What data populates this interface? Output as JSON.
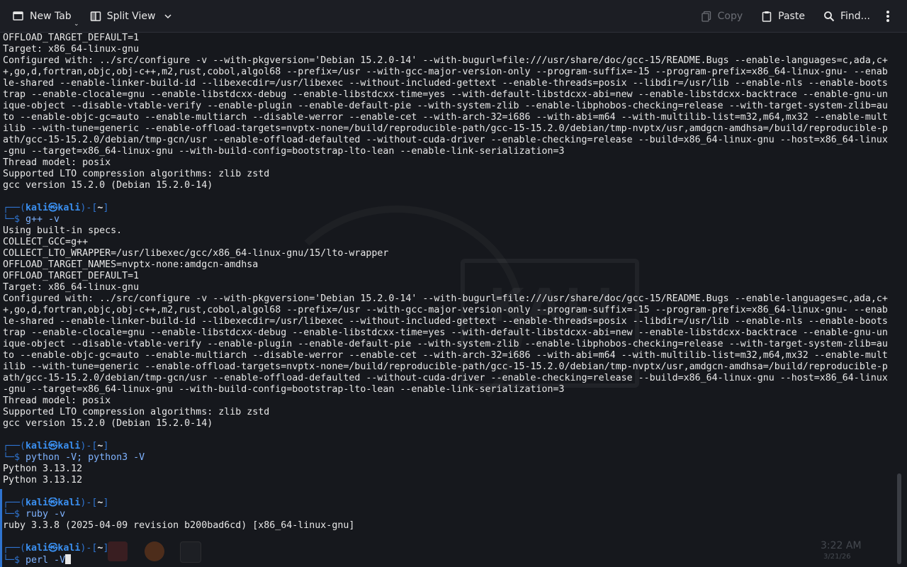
{
  "toolbar": {
    "new_tab": "New Tab",
    "split_view": "Split View",
    "copy": "Copy",
    "paste": "Paste",
    "find": "Find..."
  },
  "prompt": {
    "user": "kali",
    "host": "kali",
    "cwd": "~"
  },
  "terminal": {
    "lines": [
      {
        "type": "out",
        "text": "OFFLOAD_TARGET_DEFAULT=1"
      },
      {
        "type": "out",
        "text": "Target: x86_64-linux-gnu"
      },
      {
        "type": "out",
        "text": "Configured with: ../src/configure -v --with-pkgversion='Debian 15.2.0-14' --with-bugurl=file:///usr/share/doc/gcc-15/README.Bugs --enable-languages=c,ada,c+"
      },
      {
        "type": "out",
        "text": "+,go,d,fortran,objc,obj-c++,m2,rust,cobol,algol68 --prefix=/usr --with-gcc-major-version-only --program-suffix=-15 --program-prefix=x86_64-linux-gnu- --enab"
      },
      {
        "type": "out",
        "text": "le-shared --enable-linker-build-id --libexecdir=/usr/libexec --without-included-gettext --enable-threads=posix --libdir=/usr/lib --enable-nls --enable-boots"
      },
      {
        "type": "out",
        "text": "trap --enable-clocale=gnu --enable-libstdcxx-debug --enable-libstdcxx-time=yes --with-default-libstdcxx-abi=new --enable-libstdcxx-backtrace --enable-gnu-un"
      },
      {
        "type": "out",
        "text": "ique-object --disable-vtable-verify --enable-plugin --enable-default-pie --with-system-zlib --enable-libphobos-checking=release --with-target-system-zlib=au"
      },
      {
        "type": "out",
        "text": "to --enable-objc-gc=auto --enable-multiarch --disable-werror --enable-cet --with-arch-32=i686 --with-abi=m64 --with-multilib-list=m32,m64,mx32 --enable-mult"
      },
      {
        "type": "out",
        "text": "ilib --with-tune=generic --enable-offload-targets=nvptx-none=/build/reproducible-path/gcc-15-15.2.0/debian/tmp-nvptx/usr,amdgcn-amdhsa=/build/reproducible-p"
      },
      {
        "type": "out",
        "text": "ath/gcc-15-15.2.0/debian/tmp-gcn/usr --enable-offload-defaulted --without-cuda-driver --enable-checking=release --build=x86_64-linux-gnu --host=x86_64-linux"
      },
      {
        "type": "out",
        "text": "-gnu --target=x86_64-linux-gnu --with-build-config=bootstrap-lto-lean --enable-link-serialization=3"
      },
      {
        "type": "out",
        "text": "Thread model: posix"
      },
      {
        "type": "out",
        "text": "Supported LTO compression algorithms: zlib zstd"
      },
      {
        "type": "out",
        "text": "gcc version 15.2.0 (Debian 15.2.0-14)"
      },
      {
        "type": "blank",
        "text": ""
      },
      {
        "type": "ptop",
        "text": ""
      },
      {
        "type": "pcmd",
        "text": "g++ -v"
      },
      {
        "type": "out",
        "text": "Using built-in specs."
      },
      {
        "type": "out",
        "text": "COLLECT_GCC=g++"
      },
      {
        "type": "out",
        "text": "COLLECT_LTO_WRAPPER=/usr/libexec/gcc/x86_64-linux-gnu/15/lto-wrapper"
      },
      {
        "type": "out",
        "text": "OFFLOAD_TARGET_NAMES=nvptx-none:amdgcn-amdhsa"
      },
      {
        "type": "out",
        "text": "OFFLOAD_TARGET_DEFAULT=1"
      },
      {
        "type": "out",
        "text": "Target: x86_64-linux-gnu"
      },
      {
        "type": "out",
        "text": "Configured with: ../src/configure -v --with-pkgversion='Debian 15.2.0-14' --with-bugurl=file:///usr/share/doc/gcc-15/README.Bugs --enable-languages=c,ada,c+"
      },
      {
        "type": "out",
        "text": "+,go,d,fortran,objc,obj-c++,m2,rust,cobol,algol68 --prefix=/usr --with-gcc-major-version-only --program-suffix=-15 --program-prefix=x86_64-linux-gnu- --enab"
      },
      {
        "type": "out",
        "text": "le-shared --enable-linker-build-id --libexecdir=/usr/libexec --without-included-gettext --enable-threads=posix --libdir=/usr/lib --enable-nls --enable-boots"
      },
      {
        "type": "out",
        "text": "trap --enable-clocale=gnu --enable-libstdcxx-debug --enable-libstdcxx-time=yes --with-default-libstdcxx-abi=new --enable-libstdcxx-backtrace --enable-gnu-un"
      },
      {
        "type": "out",
        "text": "ique-object --disable-vtable-verify --enable-plugin --enable-default-pie --with-system-zlib --enable-libphobos-checking=release --with-target-system-zlib=au"
      },
      {
        "type": "out",
        "text": "to --enable-objc-gc=auto --enable-multiarch --disable-werror --enable-cet --with-arch-32=i686 --with-abi=m64 --with-multilib-list=m32,m64,mx32 --enable-mult"
      },
      {
        "type": "out",
        "text": "ilib --with-tune=generic --enable-offload-targets=nvptx-none=/build/reproducible-path/gcc-15-15.2.0/debian/tmp-nvptx/usr,amdgcn-amdhsa=/build/reproducible-p"
      },
      {
        "type": "out",
        "text": "ath/gcc-15-15.2.0/debian/tmp-gcn/usr --enable-offload-defaulted --without-cuda-driver --enable-checking=release --build=x86_64-linux-gnu --host=x86_64-linux"
      },
      {
        "type": "out",
        "text": "-gnu --target=x86_64-linux-gnu --with-build-config=bootstrap-lto-lean --enable-link-serialization=3"
      },
      {
        "type": "out",
        "text": "Thread model: posix"
      },
      {
        "type": "out",
        "text": "Supported LTO compression algorithms: zlib zstd"
      },
      {
        "type": "out",
        "text": "gcc version 15.2.0 (Debian 15.2.0-14)"
      },
      {
        "type": "blank",
        "text": ""
      },
      {
        "type": "ptop",
        "text": ""
      },
      {
        "type": "pcmd",
        "text": "python -V; python3 -V"
      },
      {
        "type": "out",
        "text": "Python 3.13.12"
      },
      {
        "type": "out",
        "text": "Python 3.13.12"
      },
      {
        "type": "blank",
        "text": ""
      },
      {
        "type": "ptop",
        "text": ""
      },
      {
        "type": "pcmd",
        "text": "ruby -v"
      },
      {
        "type": "out",
        "text": "ruby 3.3.8 (2025-04-09 revision b200bad6cd) [x86_64-linux-gnu]"
      },
      {
        "type": "blank",
        "text": ""
      },
      {
        "type": "ptop",
        "text": ""
      },
      {
        "type": "pcur",
        "text": "perl -V"
      }
    ]
  },
  "taskbar": {
    "clock": "3:22 AM",
    "date": "3/21/26"
  },
  "colors": {
    "background": "#16181d",
    "toolbar": "#1c1e24",
    "prompt_accent": "#2f74d0",
    "user_host": "#3a8ff0"
  }
}
